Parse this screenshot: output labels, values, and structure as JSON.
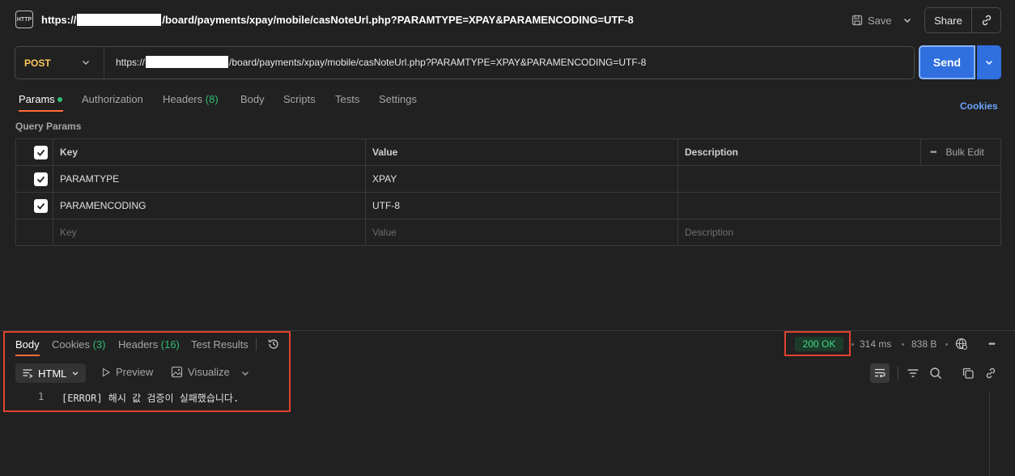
{
  "header": {
    "icon_label": "HTTP",
    "url_prefix": "https://",
    "url_suffix": "/board/payments/xpay/mobile/casNoteUrl.php?PARAMTYPE=XPAY&PARAMENCODING=UTF-8",
    "save_label": "Save",
    "share_label": "Share"
  },
  "request": {
    "method": "POST",
    "url_prefix": "https://",
    "url_suffix": "/board/payments/xpay/mobile/casNoteUrl.php?PARAMTYPE=XPAY&PARAMENCODING=UTF-8",
    "send_label": "Send"
  },
  "tabs": {
    "params": "Params",
    "authorization": "Authorization",
    "headers": "Headers",
    "headers_count": "(8)",
    "body": "Body",
    "scripts": "Scripts",
    "tests": "Tests",
    "settings": "Settings",
    "cookies": "Cookies"
  },
  "query_params": {
    "title": "Query Params",
    "columns": {
      "key": "Key",
      "value": "Value",
      "description": "Description",
      "bulk_edit": "Bulk Edit"
    },
    "rows": [
      {
        "key": "PARAMTYPE",
        "value": "XPAY",
        "description": "",
        "checked": true
      },
      {
        "key": "PARAMENCODING",
        "value": "UTF-8",
        "description": "",
        "checked": true
      }
    ],
    "placeholder": {
      "key": "Key",
      "value": "Value",
      "description": "Description"
    }
  },
  "response": {
    "tabs": {
      "body": "Body",
      "cookies": "Cookies",
      "cookies_count": "(3)",
      "headers": "Headers",
      "headers_count": "(16)",
      "test_results": "Test Results"
    },
    "status": "200 OK",
    "time": "314 ms",
    "size": "838 B",
    "format": "HTML",
    "preview_label": "Preview",
    "visualize_label": "Visualize",
    "lines": [
      {
        "number": "1",
        "text": "[ERROR] 해시 값 검증이 실패했습니다."
      }
    ]
  },
  "colors": {
    "accent_orange": "#ff6c37",
    "send_blue": "#2f6fde",
    "status_green": "#3ddc84",
    "highlight_red": "#e0412f",
    "method_yellow": "#ffc857"
  }
}
